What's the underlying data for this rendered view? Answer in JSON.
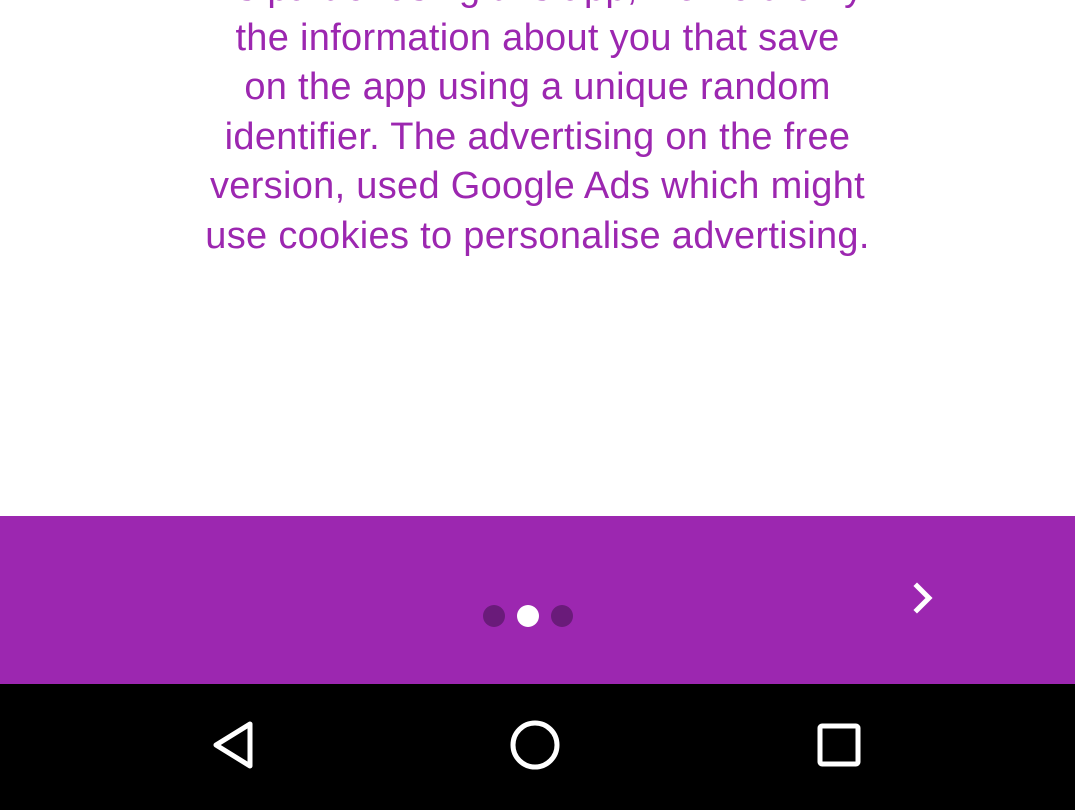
{
  "privacy": {
    "text_lines": [
      "As part of using this app, we hold only",
      "the information about you that save",
      "on the app using a unique random",
      "identifier. The advertising on the free",
      "version, used Google Ads which might",
      "use cookies to personalise advertising."
    ]
  },
  "pager": {
    "total_pages": 3,
    "current_page": 2,
    "next_icon": "chevron-right-icon"
  },
  "system_nav": {
    "back_icon": "back-triangle-icon",
    "home_icon": "home-circle-icon",
    "recents_icon": "recents-square-icon"
  },
  "colors": {
    "accent": "#9c27b0",
    "dot_inactive": "#6a1b7a",
    "dot_active": "#ffffff",
    "nav_background": "#000000"
  }
}
